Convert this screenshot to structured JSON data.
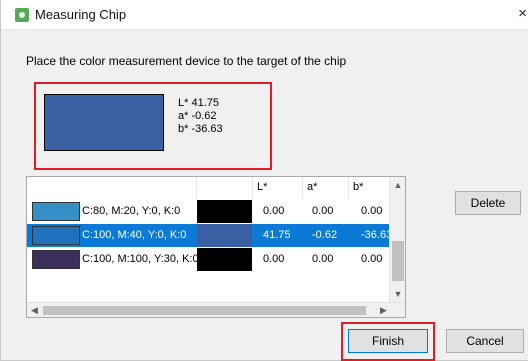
{
  "window": {
    "title": "Measuring Chip",
    "close_glyph": "×"
  },
  "instruction": "Place the color measurement device to the target of the chip",
  "preview": {
    "swatch_color": "#3a5fa3",
    "L": "L* 41.75",
    "a": "a* -0.62",
    "b": "b* -36.63"
  },
  "table": {
    "headers": [
      "L*",
      "a*",
      "b*"
    ],
    "rows": [
      {
        "swatch_color": "#3590c8",
        "name": "C:80, M:20, Y:0, K:0",
        "sample_color": "#000000",
        "L": "0.00",
        "a": "0.00",
        "b": "0.00",
        "selected": false
      },
      {
        "swatch_color": "#1f73bd",
        "name": "C:100, M:40, Y:0, K:0",
        "sample_color": "#3a5fa3",
        "L": "41.75",
        "a": "-0.62",
        "b": "-36.63",
        "selected": true
      },
      {
        "swatch_color": "#3b2e5a",
        "name": "C:100, M:100, Y:30, K:0",
        "sample_color": "#000000",
        "L": "0.00",
        "a": "0.00",
        "b": "0.00",
        "selected": false
      }
    ]
  },
  "buttons": {
    "delete": "Delete",
    "finish": "Finish",
    "cancel": "Cancel"
  },
  "colors": {
    "highlight": "#e01e24",
    "selection": "#0a7ad6"
  }
}
